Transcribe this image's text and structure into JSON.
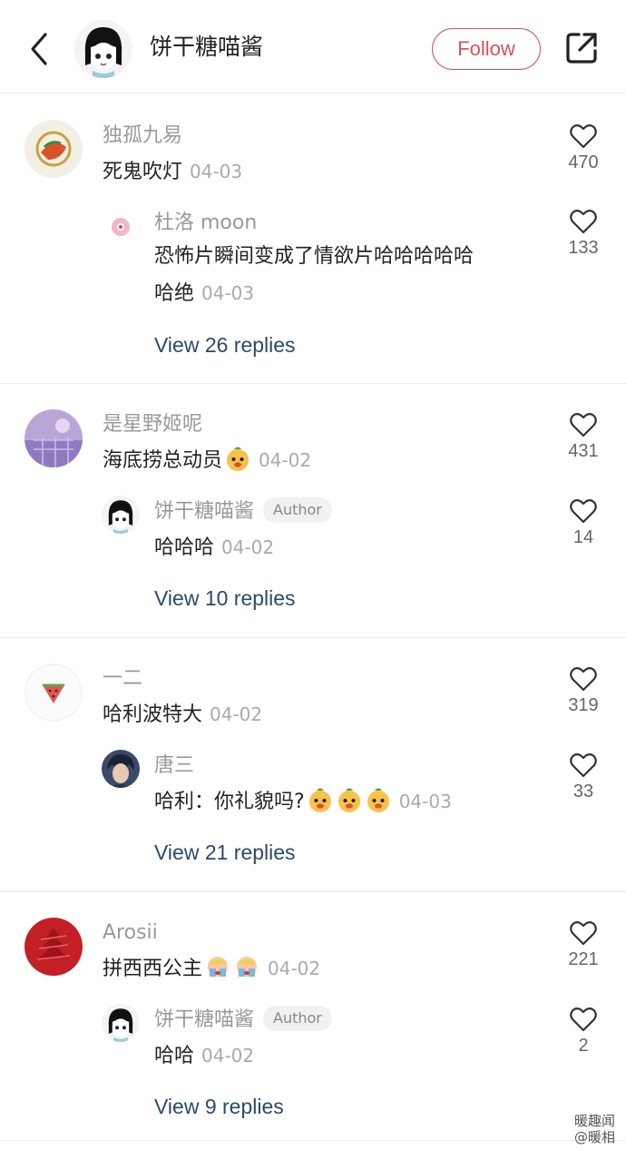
{
  "header": {
    "author_name": "饼干糖喵酱",
    "follow_label": "Follow"
  },
  "threads": [
    {
      "comment": {
        "user": "独孤九易",
        "text": "死鬼吹灯",
        "date": "04-03",
        "likes": "470"
      },
      "reply": {
        "user": "杜洛 moon",
        "text_line1": "恐怖片瞬间变成了情欲片哈哈哈哈哈",
        "text_line2": "哈绝",
        "date": "04-03",
        "likes": "133"
      },
      "view_replies": "View 26 replies"
    },
    {
      "comment": {
        "user": "是星野姬呢",
        "text": "海底捞总动员",
        "date": "04-02",
        "likes": "431"
      },
      "reply": {
        "user": "饼干糖喵酱",
        "badge": "Author",
        "text": "哈哈哈",
        "date": "04-02",
        "likes": "14"
      },
      "view_replies": "View 10 replies"
    },
    {
      "comment": {
        "user": "一二",
        "text": "哈利波特大",
        "date": "04-02",
        "likes": "319"
      },
      "reply": {
        "user": "唐三",
        "text": "哈利：你礼貌吗?",
        "date": "04-03",
        "likes": "33"
      },
      "view_replies": "View 21 replies"
    },
    {
      "comment": {
        "user": "Arosii",
        "text": "拼西西公主",
        "date": "04-02",
        "likes": "221"
      },
      "reply": {
        "user": "饼干糖喵酱",
        "badge": "Author",
        "text": "哈哈",
        "date": "04-02",
        "likes": "2"
      },
      "view_replies": "View 9 replies"
    }
  ],
  "watermark": {
    "line1": "暖趣闻",
    "line2": "@暖相"
  },
  "icons": {
    "back": "chevron-left-icon",
    "share": "share-external-icon",
    "like": "heart-outline-icon"
  },
  "colors": {
    "follow_accent": "#d9505c",
    "view_replies": "#2a4a6c"
  }
}
